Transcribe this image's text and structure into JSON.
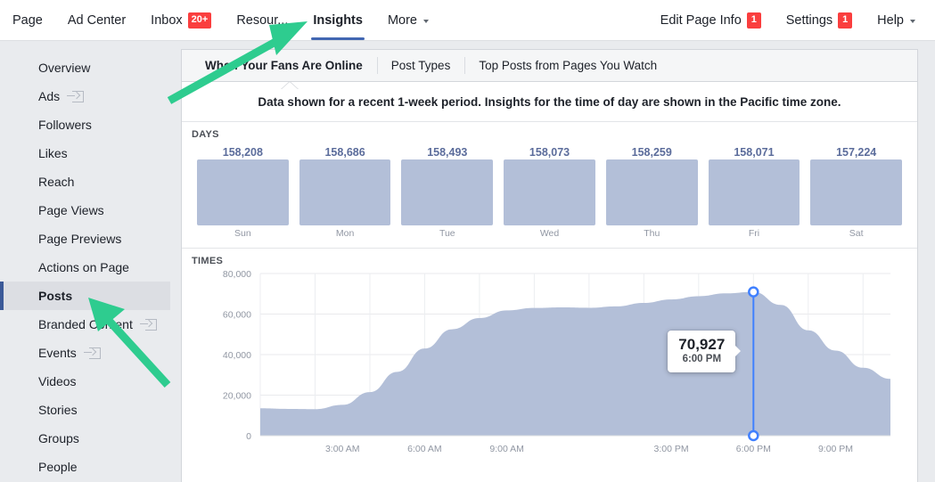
{
  "topnav": {
    "left_items": [
      {
        "label": "Page",
        "badge": null,
        "caret": false,
        "active": false
      },
      {
        "label": "Ad Center",
        "badge": null,
        "caret": false,
        "active": false
      },
      {
        "label": "Inbox",
        "badge": "20+",
        "caret": false,
        "active": false
      },
      {
        "label": "Resour...",
        "badge": null,
        "caret": false,
        "active": false
      },
      {
        "label": "Insights",
        "badge": null,
        "caret": false,
        "active": true
      },
      {
        "label": "More",
        "badge": null,
        "caret": true,
        "active": false
      }
    ],
    "right_items": [
      {
        "label": "Edit Page Info",
        "badge": "1",
        "caret": false
      },
      {
        "label": "Settings",
        "badge": "1",
        "caret": false
      },
      {
        "label": "Help",
        "badge": null,
        "caret": true
      }
    ]
  },
  "sidebar": {
    "items": [
      {
        "label": "Overview",
        "external": false,
        "active": false
      },
      {
        "label": "Ads",
        "external": true,
        "active": false
      },
      {
        "label": "Followers",
        "external": false,
        "active": false
      },
      {
        "label": "Likes",
        "external": false,
        "active": false
      },
      {
        "label": "Reach",
        "external": false,
        "active": false
      },
      {
        "label": "Page Views",
        "external": false,
        "active": false
      },
      {
        "label": "Page Previews",
        "external": false,
        "active": false
      },
      {
        "label": "Actions on Page",
        "external": false,
        "active": false
      },
      {
        "label": "Posts",
        "external": false,
        "active": true
      },
      {
        "label": "Branded Content",
        "external": true,
        "active": false
      },
      {
        "label": "Events",
        "external": true,
        "active": false
      },
      {
        "label": "Videos",
        "external": false,
        "active": false
      },
      {
        "label": "Stories",
        "external": false,
        "active": false
      },
      {
        "label": "Groups",
        "external": false,
        "active": false
      },
      {
        "label": "People",
        "external": false,
        "active": false
      }
    ]
  },
  "card": {
    "tabs": [
      {
        "label": "When Your Fans Are Online",
        "active": true
      },
      {
        "label": "Post Types",
        "active": false
      },
      {
        "label": "Top Posts from Pages You Watch",
        "active": false
      }
    ],
    "note": "Data shown for a recent 1-week period. Insights for the time of day are shown in the Pacific time zone.",
    "days_label": "DAYS",
    "times_label": "TIMES"
  },
  "tooltip": {
    "value": "70,927",
    "time": "6:00 PM"
  },
  "colors": {
    "accent": "#4267b2",
    "series": "#b3bfd8",
    "value_text": "#5b6c9b",
    "badge": "#fa3e3e",
    "annotation": "#2ecc8f"
  },
  "chart_data": [
    {
      "type": "bar",
      "title": "DAYS",
      "categories": [
        "Sun",
        "Mon",
        "Tue",
        "Wed",
        "Thu",
        "Fri",
        "Sat"
      ],
      "values": [
        158208,
        158686,
        158493,
        158073,
        158259,
        158071,
        157224
      ],
      "value_labels": [
        "158,208",
        "158,686",
        "158,493",
        "158,073",
        "158,259",
        "158,071",
        "157,224"
      ],
      "xlabel": "",
      "ylabel": "",
      "grid": false
    },
    {
      "type": "area",
      "title": "TIMES",
      "xlabel": "",
      "ylabel": "",
      "ylim": [
        0,
        80000
      ],
      "yticks": [
        0,
        20000,
        40000,
        60000,
        80000
      ],
      "ytick_labels": [
        "0",
        "20,000",
        "40,000",
        "60,000",
        "80,000"
      ],
      "xticks": [
        "3:00 AM",
        "6:00 AM",
        "9:00 AM",
        "3:00 PM",
        "6:00 PM",
        "9:00 PM"
      ],
      "grid": true,
      "highlight": {
        "x": "6:00 PM",
        "y": 70927,
        "label": "70,927"
      },
      "x": [
        "12:00 AM",
        "1:00 AM",
        "2:00 AM",
        "3:00 AM",
        "4:00 AM",
        "5:00 AM",
        "6:00 AM",
        "7:00 AM",
        "8:00 AM",
        "9:00 AM",
        "10:00 AM",
        "11:00 AM",
        "12:00 PM",
        "1:00 PM",
        "2:00 PM",
        "3:00 PM",
        "4:00 PM",
        "5:00 PM",
        "6:00 PM",
        "7:00 PM",
        "8:00 PM",
        "9:00 PM",
        "10:00 PM",
        "11:00 PM"
      ],
      "values": [
        13500,
        13200,
        13100,
        15200,
        21500,
        31500,
        43000,
        52500,
        58000,
        61800,
        63000,
        63300,
        63100,
        63800,
        65500,
        67200,
        68800,
        70200,
        70927,
        64500,
        52000,
        42000,
        33500,
        28000
      ]
    }
  ],
  "annotations": [
    {
      "name": "arrow-to-insights-tab"
    },
    {
      "name": "arrow-to-posts-sidebar"
    }
  ]
}
